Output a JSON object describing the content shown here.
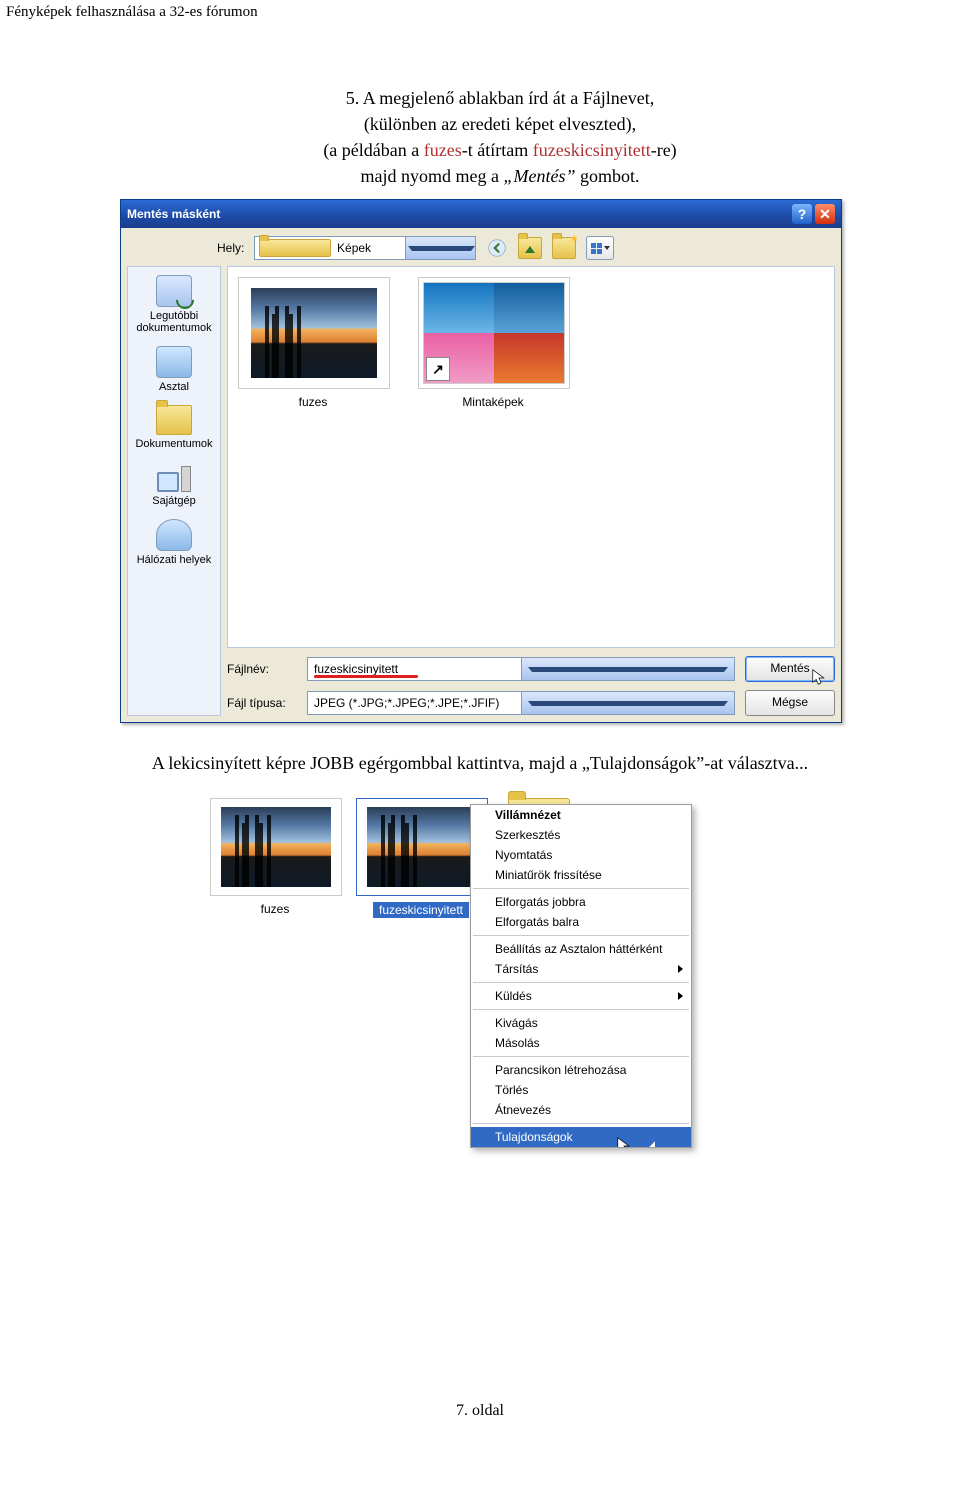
{
  "page": {
    "header": "Fényképek felhasználása a 32-es fórumon",
    "instruction": {
      "line1": "5. A megjelenő ablakban írd át a Fájlnevet,",
      "line2": "(különben az eredeti képet elveszted),",
      "line3_a": "(a példában a ",
      "line3_b": "fuzes",
      "line3_c": "-t átírtam ",
      "line3_d": "fuzeskicsinyitett",
      "line3_e": "-re)",
      "line4_a": "majd nyomd meg a ",
      "line4_b": "„Mentés”",
      "line4_c": " gombot."
    },
    "followup": "A lekicsinyített képre JOBB egérgombbal kattintva, majd a „Tulajdonságok”-at választva...",
    "footer": "7. oldal"
  },
  "dialog": {
    "title": "Mentés másként",
    "location_label": "Hely:",
    "location_value": "Képek",
    "places": {
      "recent": "Legutóbbi dokumentumok",
      "desktop": "Asztal",
      "documents": "Dokumentumok",
      "mycomputer": "Sajátgép",
      "network": "Hálózati helyek"
    },
    "files": {
      "item1": "fuzes",
      "item2": "Mintaképek"
    },
    "filename_label": "Fájlnév:",
    "filename_value": "fuzeskicsinyitett",
    "filetype_label": "Fájl típusa:",
    "filetype_value": "JPEG (*.JPG;*.JPEG;*.JPE;*.JFIF)",
    "save_btn": "Mentés",
    "cancel_btn": "Mégse"
  },
  "context": {
    "file1_label": "fuzes",
    "file2_label": "fuzeskicsinyitett",
    "menu": {
      "preview": "Villámnézet",
      "edit": "Szerkesztés",
      "print": "Nyomtatás",
      "refresh": "Miniatűrök frissítése",
      "rot_r": "Elforgatás jobbra",
      "rot_l": "Elforgatás balra",
      "setbg": "Beállítás az Asztalon háttérként",
      "openwith": "Társítás",
      "sendto": "Küldés",
      "cut": "Kivágás",
      "copy": "Másolás",
      "shortcut": "Parancsikon létrehozása",
      "delete": "Törlés",
      "rename": "Átnevezés",
      "props": "Tulajdonságok"
    }
  }
}
